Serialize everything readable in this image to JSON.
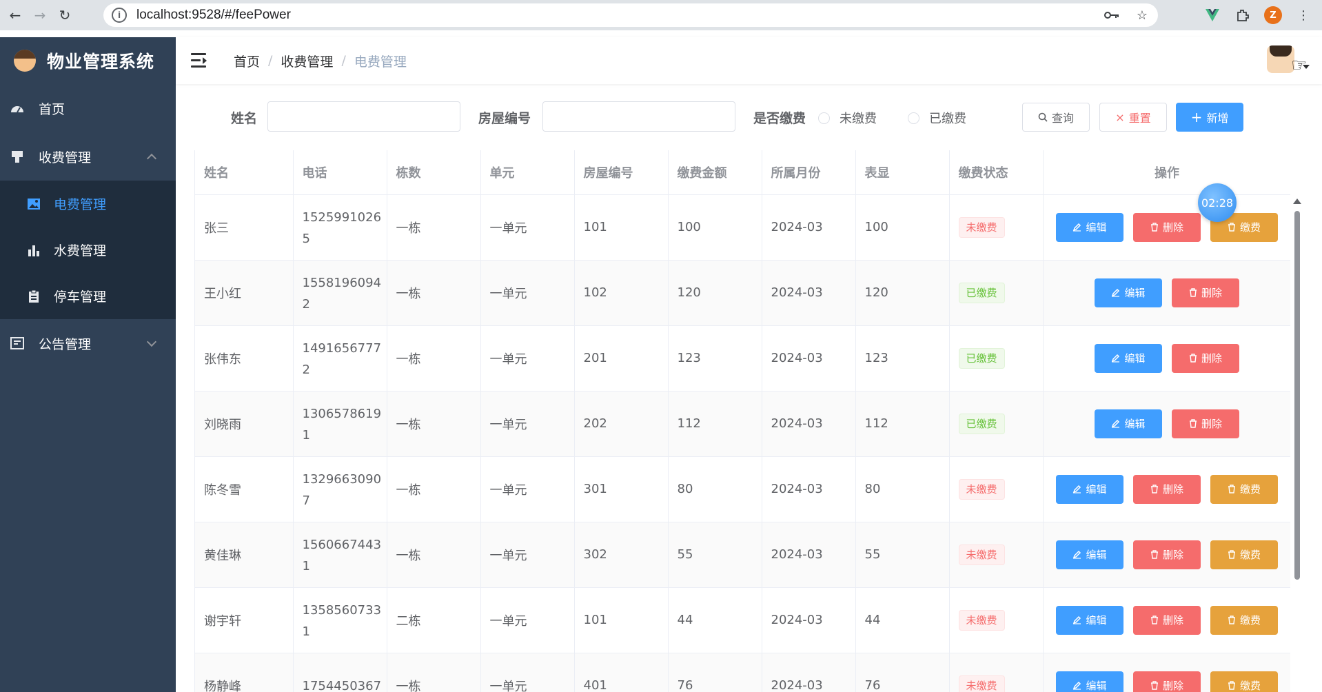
{
  "browser": {
    "url": "localhost:9528/#/feePower"
  },
  "sidebar": {
    "title": "物业管理系统",
    "items": [
      {
        "label": "首页",
        "icon": "dashboard-icon"
      },
      {
        "label": "收费管理",
        "icon": "bill-icon",
        "expanded": true,
        "children": [
          {
            "label": "电费管理",
            "icon": "picture-icon",
            "active": true
          },
          {
            "label": "水费管理",
            "icon": "bar-chart-icon"
          },
          {
            "label": "停车管理",
            "icon": "clipboard-icon"
          }
        ]
      },
      {
        "label": "公告管理",
        "icon": "notice-icon",
        "expanded": false
      }
    ]
  },
  "breadcrumb": [
    "首页",
    "收费管理",
    "电费管理"
  ],
  "search": {
    "name_label": "姓名",
    "name_value": "",
    "house_label": "房屋编号",
    "house_value": "",
    "paid_label": "是否缴费",
    "paid_options": [
      "未缴费",
      "已缴费"
    ],
    "query_label": "查询",
    "reset_label": "重置",
    "add_label": "新增"
  },
  "table": {
    "columns": [
      "姓名",
      "电话",
      "栋数",
      "单元",
      "房屋编号",
      "缴费金额",
      "所属月份",
      "表显",
      "缴费状态",
      "操作"
    ],
    "edit_label": "编辑",
    "delete_label": "删除",
    "pay_label": "缴费",
    "rows": [
      {
        "name": "张三",
        "phone1": "1525991026",
        "phone2": "5",
        "building": "一栋",
        "unit": "一单元",
        "house": "101",
        "amount": "100",
        "month": "2024-03",
        "meter": "100",
        "status": "未缴费",
        "paid": false
      },
      {
        "name": "王小红",
        "phone1": "1558196094",
        "phone2": "2",
        "building": "一栋",
        "unit": "一单元",
        "house": "102",
        "amount": "120",
        "month": "2024-03",
        "meter": "120",
        "status": "已缴费",
        "paid": true
      },
      {
        "name": "张伟东",
        "phone1": "1491656777",
        "phone2": "2",
        "building": "一栋",
        "unit": "一单元",
        "house": "201",
        "amount": "123",
        "month": "2024-03",
        "meter": "123",
        "status": "已缴费",
        "paid": true
      },
      {
        "name": "刘晓雨",
        "phone1": "1306578619",
        "phone2": "1",
        "building": "一栋",
        "unit": "一单元",
        "house": "202",
        "amount": "112",
        "month": "2024-03",
        "meter": "112",
        "status": "已缴费",
        "paid": true
      },
      {
        "name": "陈冬雪",
        "phone1": "1329663090",
        "phone2": "7",
        "building": "一栋",
        "unit": "一单元",
        "house": "301",
        "amount": "80",
        "month": "2024-03",
        "meter": "80",
        "status": "未缴费",
        "paid": false
      },
      {
        "name": "黄佳琳",
        "phone1": "1560667443",
        "phone2": "1",
        "building": "一栋",
        "unit": "一单元",
        "house": "302",
        "amount": "55",
        "month": "2024-03",
        "meter": "55",
        "status": "未缴费",
        "paid": false
      },
      {
        "name": "谢宇轩",
        "phone1": "1358560733",
        "phone2": "1",
        "building": "二栋",
        "unit": "一单元",
        "house": "101",
        "amount": "44",
        "month": "2024-03",
        "meter": "44",
        "status": "未缴费",
        "paid": false
      },
      {
        "name": "杨静峰",
        "phone1": "1754450367",
        "phone2": "",
        "building": "一栋",
        "unit": "一单元",
        "house": "401",
        "amount": "76",
        "month": "2024-03",
        "meter": "76",
        "status": "未缴费",
        "paid": false
      }
    ]
  },
  "timer": "02:28",
  "colors": {
    "sidebar_bg": "#304156",
    "submenu_bg": "#1f2d3d",
    "primary": "#409eff",
    "danger": "#f56c6c",
    "warning": "#e6a23c",
    "success": "#67c23a"
  }
}
